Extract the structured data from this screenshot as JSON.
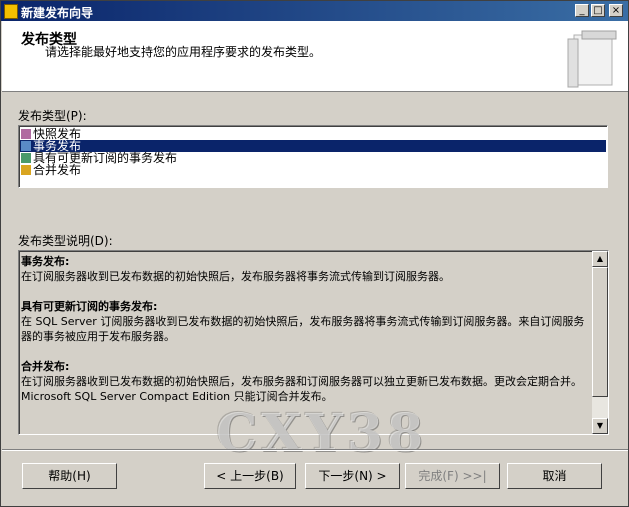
{
  "window": {
    "title": "新建发布向导",
    "minimize": "_",
    "maximize": "□",
    "close": "×"
  },
  "header": {
    "title": "发布类型",
    "subtitle": "请选择能最好地支持您的应用程序要求的发布类型。"
  },
  "publication_type": {
    "label": "发布类型(P):",
    "items": [
      {
        "label": "快照发布",
        "icon": "snapshot-publication-icon",
        "selected": false
      },
      {
        "label": "事务发布",
        "icon": "transactional-publication-icon",
        "selected": true
      },
      {
        "label": "具有可更新订阅的事务发布",
        "icon": "updatable-transactional-publication-icon",
        "selected": false
      },
      {
        "label": "合并发布",
        "icon": "merge-publication-icon",
        "selected": false
      }
    ]
  },
  "description": {
    "label": "发布类型说明(D):",
    "sections": [
      {
        "title": "事务发布:",
        "text": "在订阅服务器收到已发布数据的初始快照后，发布服务器将事务流式传输到订阅服务器。"
      },
      {
        "title": "具有可更新订阅的事务发布:",
        "text": "在 SQL Server 订阅服务器收到已发布数据的初始快照后，发布服务器将事务流式传输到订阅服务器。来自订阅服务器的事务被应用于发布服务器。"
      },
      {
        "title": "合并发布:",
        "text": "在订阅服务器收到已发布数据的初始快照后，发布服务器和订阅服务器可以独立更新已发布数据。更改会定期合并。Microsoft SQL Server Compact Edition 只能订阅合并发布。"
      }
    ]
  },
  "buttons": {
    "help": "帮助(H)",
    "back": "< 上一步(B)",
    "next": "下一步(N) >",
    "finish": "完成(F) >>|",
    "cancel": "取消"
  },
  "watermark": "CXY38",
  "colors": {
    "title_bar": "#0a246a",
    "selection": "#0a246a",
    "dialog_bg": "#d4d0c8"
  }
}
